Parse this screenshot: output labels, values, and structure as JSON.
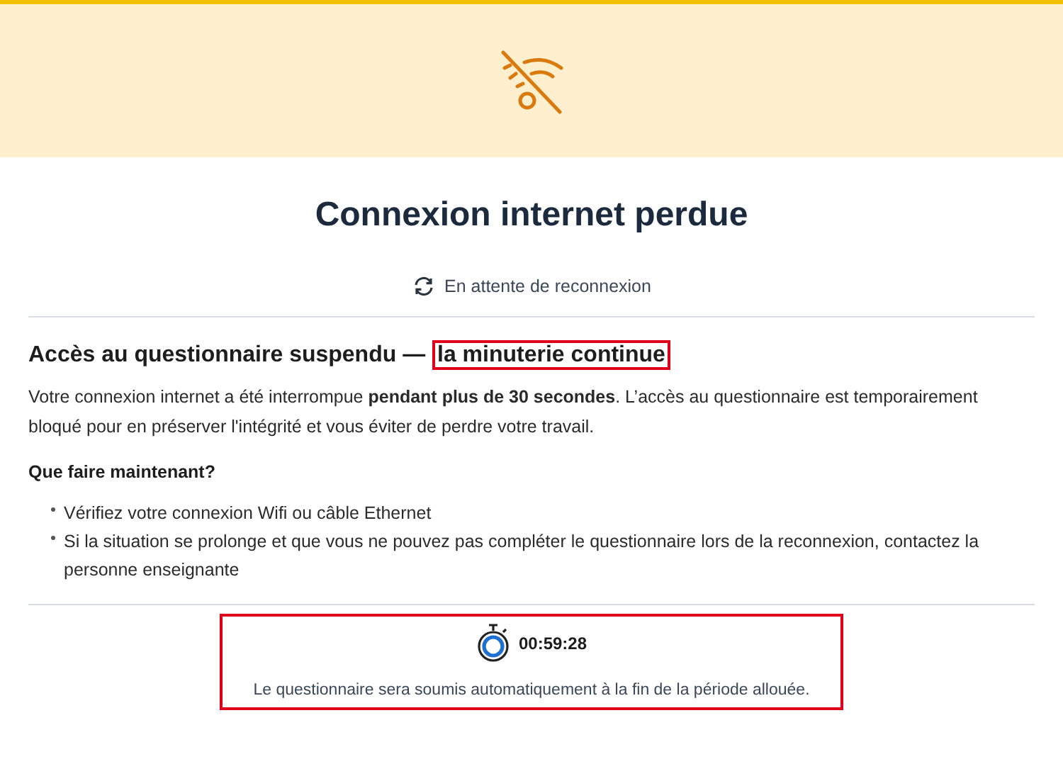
{
  "banner": {
    "kind": "wifi-off"
  },
  "title": "Connexion internet perdue",
  "status": {
    "text": "En attente de reconnexion"
  },
  "notice": {
    "heading": "Accès au questionnaire suspendu — ",
    "heading_highlight": "la minuterie continue",
    "body": "Votre connexion internet a été interrompue **pendant plus de 30 secondes**. L’accès au questionnaire est temporairement bloqué pour en préserver l'intégrité et vous éviter de perdre votre travail."
  },
  "steps": {
    "heading": "Que faire maintenant?",
    "items": [
      "Vérifiez votre connexion Wifi ou câble Ethernet",
      "Si la situation se prolonge et que vous ne pouvez pas compléter le questionnaire lors de la reconnexion, contactez la personne enseignante"
    ]
  },
  "timer": {
    "time": "00:59:28",
    "note": "Le questionnaire sera soumis automatiquement à la fin de la période allouée."
  }
}
